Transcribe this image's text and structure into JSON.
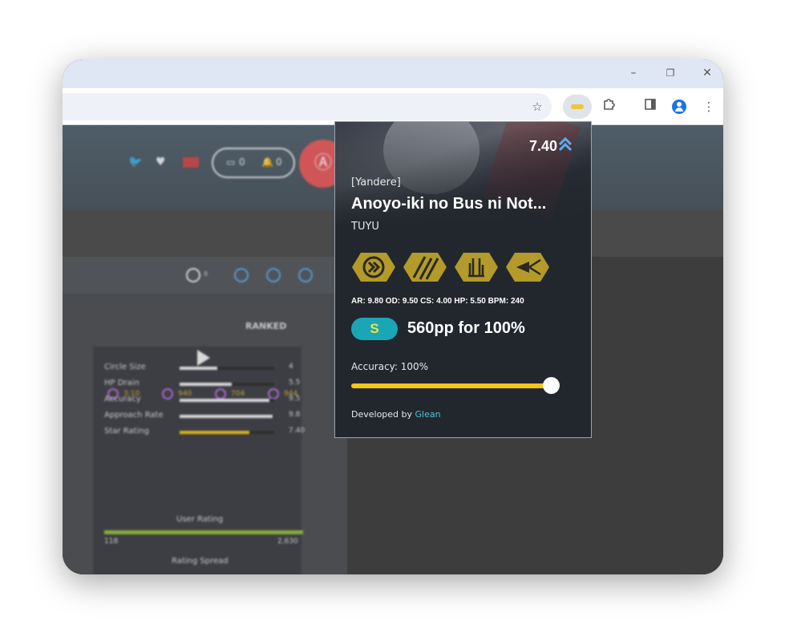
{
  "browser": {
    "window_controls": [
      "–",
      "❐",
      "✕"
    ]
  },
  "background_page": {
    "header_counts": {
      "messages": "0",
      "notifications": "0"
    },
    "mode_badge": "8",
    "status": "RANKED",
    "quick_stats": [
      "3:10",
      "940",
      "704",
      "944"
    ],
    "bars": [
      {
        "label": "Circle Size",
        "value": "4",
        "fill": 0.4
      },
      {
        "label": "HP Drain",
        "value": "5.5",
        "fill": 0.55
      },
      {
        "label": "Accuracy",
        "value": "9.5",
        "fill": 0.95
      },
      {
        "label": "Approach Rate",
        "value": "9.8",
        "fill": 0.98
      },
      {
        "label": "Star Rating",
        "value": "7.40",
        "fill": 0.74
      }
    ],
    "user_rating": {
      "label": "User Rating",
      "left": "118",
      "right": "2,630"
    },
    "rating_spread_label": "Rating Spread"
  },
  "popup": {
    "star_rating": "7.40",
    "difficulty": "[Yandere]",
    "title": "Anoyo-iki no Bus ni Not...",
    "artist": "TUYU",
    "mods": [
      "double-time-icon",
      "hidden-icon",
      "hard-rock-icon",
      "flashlight-icon"
    ],
    "stats": "AR: 9.80 OD: 9.50 CS: 4.00 HP: 5.50 BPM: 240",
    "rank": "S",
    "pp_text": "560pp for 100%",
    "accuracy_label": "Accuracy: 100%",
    "accuracy_value": 1.0,
    "developed_by": "Developed by",
    "developer": "Glean",
    "colors": {
      "accent": "#f5c518",
      "rank_bg": "#1aa6b5",
      "link": "#4fc3d9",
      "mod_bg": "#b39a2a"
    }
  }
}
